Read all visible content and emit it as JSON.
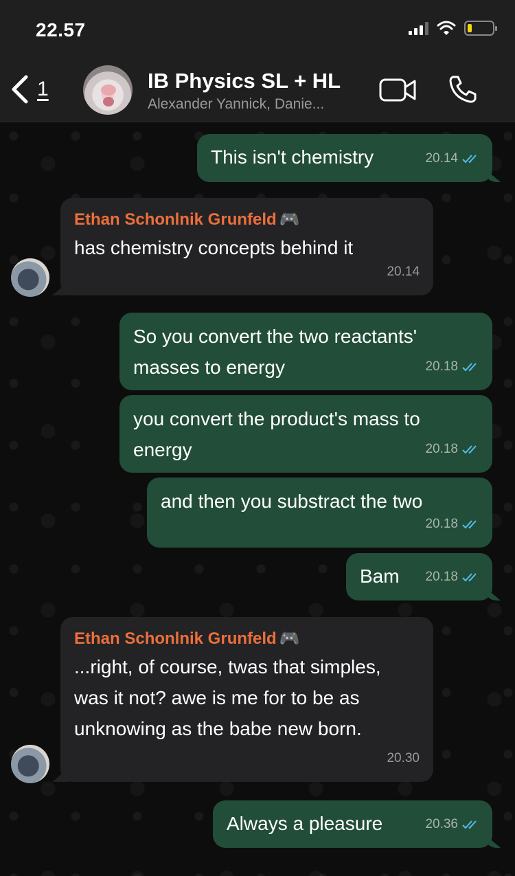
{
  "status_bar": {
    "time": "22.57"
  },
  "header": {
    "back_count": "1",
    "title": "IB Physics SL + HL",
    "subtitle": "Alexander Yannick, Danie..."
  },
  "colors": {
    "outgoing_bubble": "#224d38",
    "incoming_bubble": "#232325",
    "sender_name": "#ec6f3b",
    "read_ticks": "#53bdeb"
  },
  "messages": [
    {
      "dir": "out",
      "text": "This isn't chemistry",
      "time": "20.14",
      "status": "read"
    },
    {
      "dir": "in",
      "sender": "Ethan Schonlnik Grunfeld",
      "sender_icon": "game-controller-icon",
      "text": "has chemistry concepts behind it",
      "time": "20.14"
    },
    {
      "dir": "out",
      "text": "So you convert the two reactants' masses to energy",
      "time": "20.18",
      "status": "read"
    },
    {
      "dir": "out",
      "text": "you convert the product's mass to energy",
      "time": "20.18",
      "status": "read"
    },
    {
      "dir": "out",
      "text": "and then you substract the two",
      "time": "20.18",
      "status": "read"
    },
    {
      "dir": "out",
      "text": "Bam",
      "time": "20.18",
      "status": "read"
    },
    {
      "dir": "in",
      "sender": "Ethan Schonlnik Grunfeld",
      "sender_icon": "game-controller-icon",
      "text": "...right, of course, twas that simples, was it not? awe is me for to be as unknowing as the babe new born.",
      "time": "20.30"
    },
    {
      "dir": "out",
      "text": "Always a pleasure",
      "time": "20.36",
      "status": "read"
    }
  ]
}
